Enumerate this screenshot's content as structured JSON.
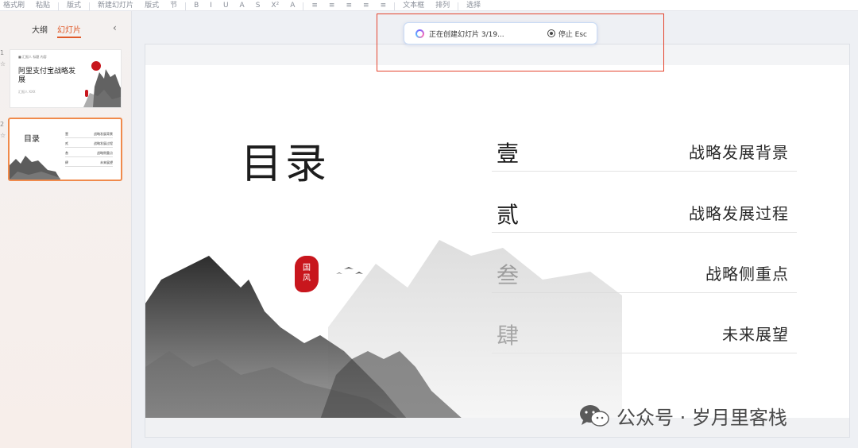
{
  "toolbar": {
    "items": [
      "格式刷",
      "粘贴",
      "",
      "版式",
      "新建幻灯片",
      "版式",
      "节",
      "B",
      "I",
      "U",
      "A",
      "S",
      "X²",
      "A",
      "",
      "",
      "",
      "",
      "",
      "",
      "",
      "",
      "文本框",
      "排列",
      "",
      "选择"
    ]
  },
  "left_panel": {
    "tabs": [
      {
        "label": "大纲"
      },
      {
        "label": "幻灯片"
      }
    ],
    "slides": [
      {
        "num": "1",
        "title": "阿里支付宝战略发展",
        "header": "■ 汇报人 标题 内容",
        "subtitle": "汇报人 XXX"
      },
      {
        "num": "2",
        "title": "目录",
        "items": [
          {
            "num": "壹",
            "label": "战略发展背景"
          },
          {
            "num": "贰",
            "label": "战略发展过程"
          },
          {
            "num": "叁",
            "label": "战略侧重点"
          },
          {
            "num": "肆",
            "label": "未来展望"
          }
        ]
      }
    ]
  },
  "toast": {
    "status_text": "正在创建幻灯片 3/19...",
    "stop_label": "停止 Esc"
  },
  "slide": {
    "title": "目录",
    "seal_text": [
      "国",
      "风"
    ],
    "toc": [
      {
        "num": "壹",
        "label": "战略发展背景"
      },
      {
        "num": "贰",
        "label": "战略发展过程"
      },
      {
        "num": "叁",
        "label": "战略侧重点"
      },
      {
        "num": "肆",
        "label": "未来展望"
      }
    ]
  },
  "watermark": {
    "text": "公众号 · 岁月里客栈"
  },
  "colors": {
    "accent": "#e05a2a",
    "highlight": "#e4442e",
    "seal": "#c8161d"
  }
}
